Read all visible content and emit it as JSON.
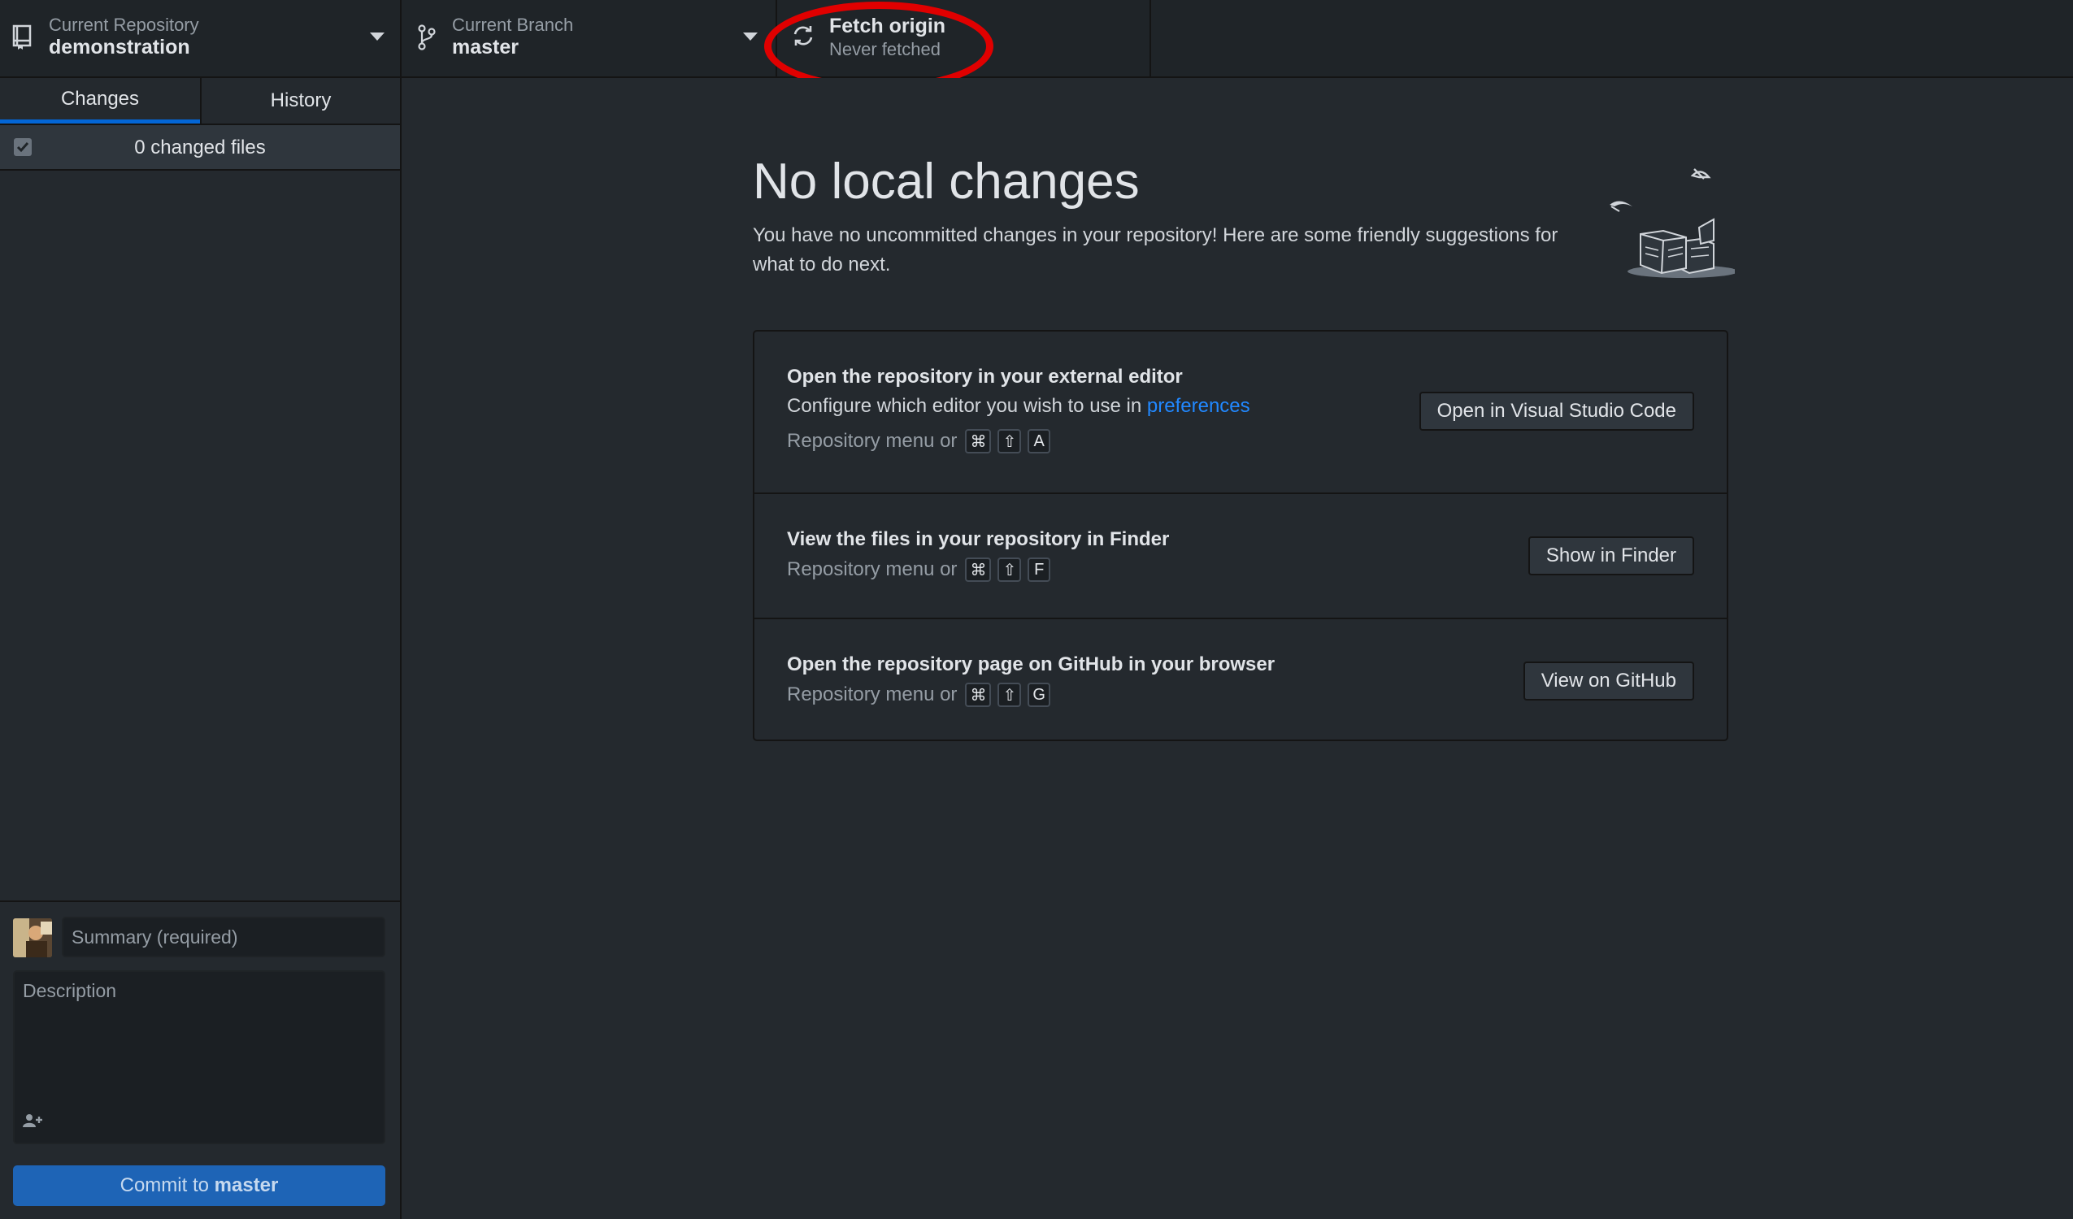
{
  "toolbar": {
    "repository": {
      "label": "Current Repository",
      "value": "demonstration",
      "icon": "repo-icon"
    },
    "branch": {
      "label": "Current Branch",
      "value": "master",
      "icon": "git-branch-icon"
    },
    "fetch": {
      "label": "Fetch origin",
      "sublabel": "Never fetched",
      "icon": "sync-icon"
    }
  },
  "sidebar": {
    "tabs": [
      {
        "label": "Changes",
        "selected": true
      },
      {
        "label": "History",
        "selected": false
      }
    ],
    "changes_count": "0 changed files",
    "commit": {
      "summary_placeholder": "Summary (required)",
      "description_placeholder": "Description",
      "button_prefix": "Commit to",
      "button_branch": "master"
    }
  },
  "main": {
    "title": "No local changes",
    "subtitle": "You have no uncommitted changes in your repository! Here are some friendly suggestions for what to do next.",
    "suggestions": [
      {
        "title": "Open the repository in your external editor",
        "desc_prefix": "Configure which editor you wish to use in",
        "desc_link": "preferences",
        "shortcut_prefix": "Repository menu or",
        "keys": [
          "⌘",
          "⇧",
          "A"
        ],
        "button": "Open in Visual Studio Code"
      },
      {
        "title": "View the files in your repository in Finder",
        "shortcut_prefix": "Repository menu or",
        "keys": [
          "⌘",
          "⇧",
          "F"
        ],
        "button": "Show in Finder"
      },
      {
        "title": "Open the repository page on GitHub in your browser",
        "shortcut_prefix": "Repository menu or",
        "keys": [
          "⌘",
          "⇧",
          "G"
        ],
        "button": "View on GitHub"
      }
    ]
  },
  "colors": {
    "accent": "#0366d6",
    "annotation": "#e00000",
    "commit_button": "#1e64b6",
    "link": "#2188ff"
  }
}
